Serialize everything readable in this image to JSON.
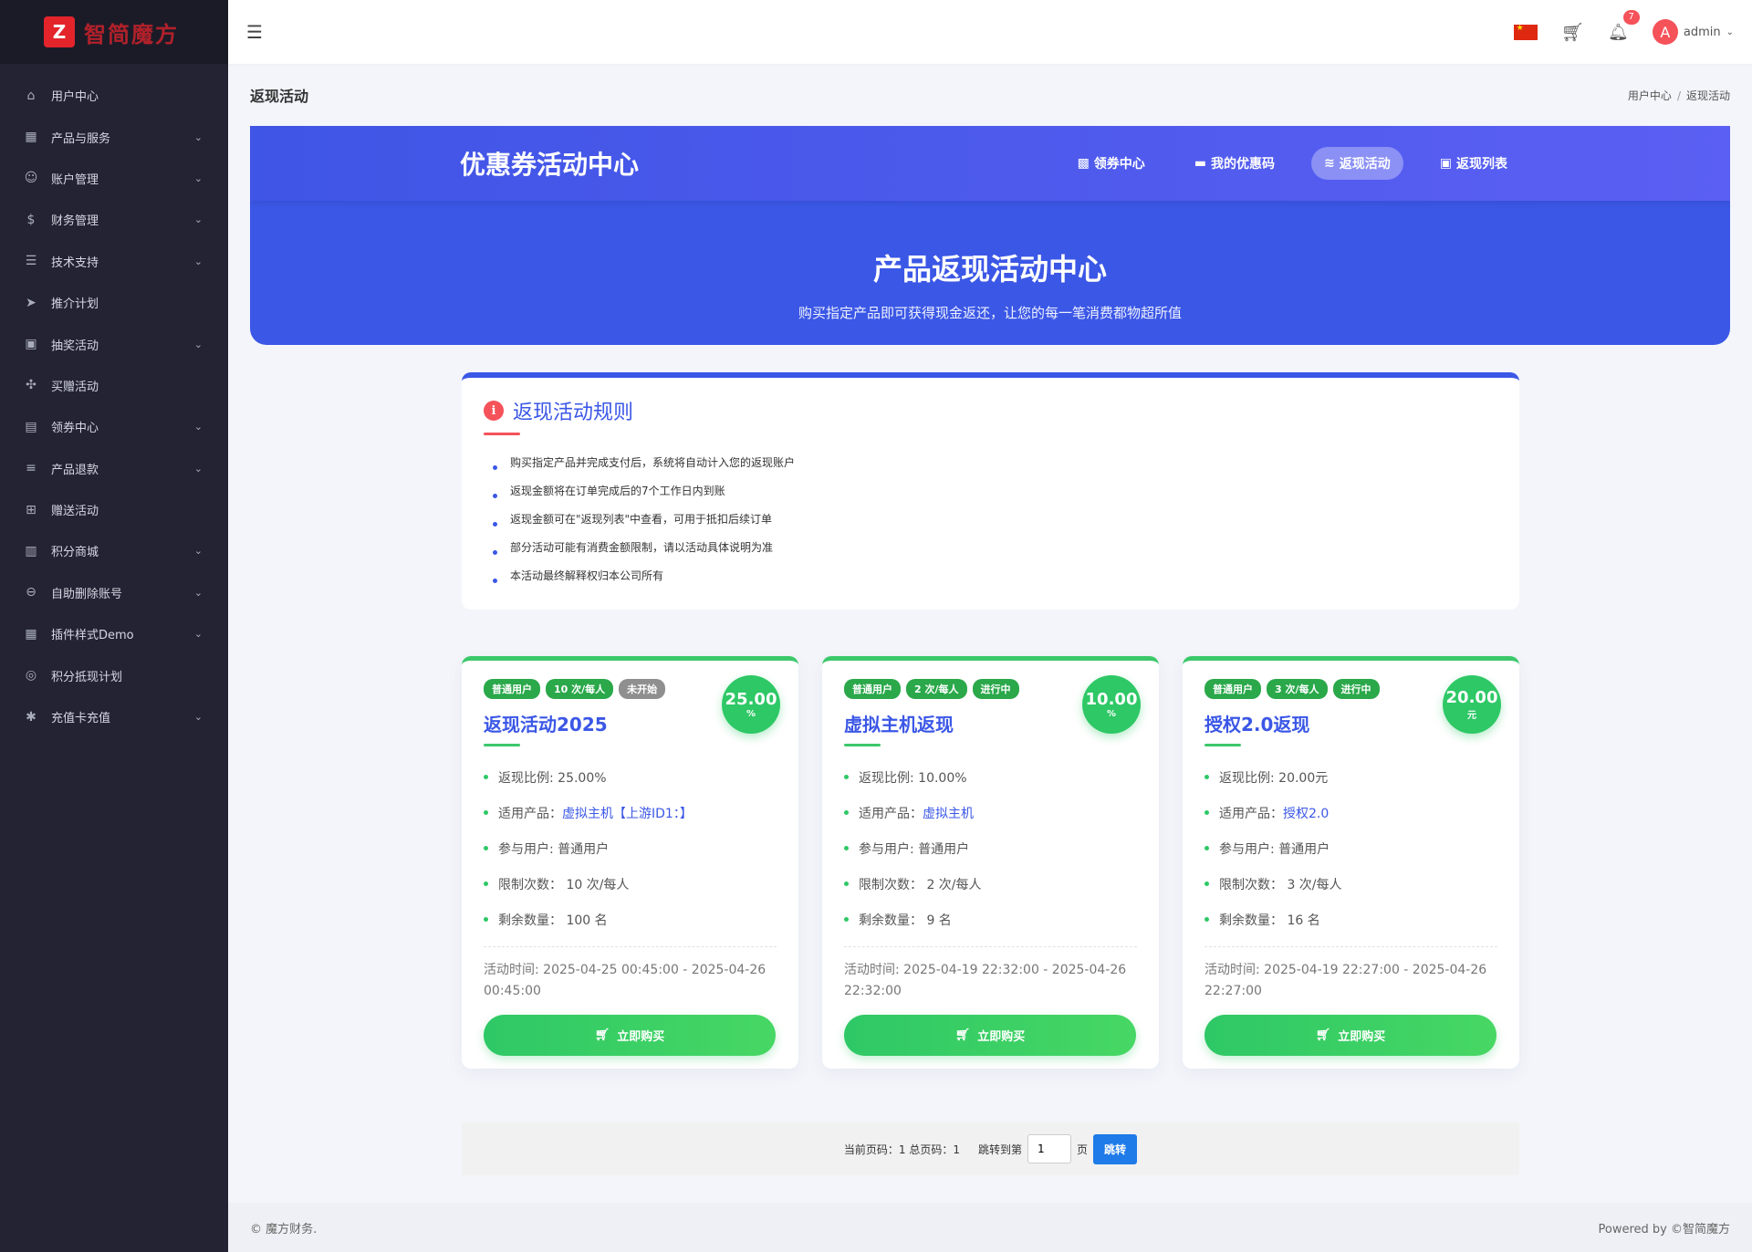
{
  "brand": {
    "logo_text": "智简魔方"
  },
  "sidebar": {
    "items": [
      {
        "label": "用户中心",
        "icon": "⌂",
        "has_children": false
      },
      {
        "label": "产品与服务",
        "icon": "▦",
        "has_children": true
      },
      {
        "label": "账户管理",
        "icon": "☺",
        "has_children": true
      },
      {
        "label": "财务管理",
        "icon": "$",
        "has_children": true
      },
      {
        "label": "技术支持",
        "icon": "☰",
        "has_children": true
      },
      {
        "label": "推介计划",
        "icon": "➤",
        "has_children": false
      },
      {
        "label": "抽奖活动",
        "icon": "▣",
        "has_children": true
      },
      {
        "label": "买赠活动",
        "icon": "✣",
        "has_children": false
      },
      {
        "label": "领券中心",
        "icon": "▤",
        "has_children": true
      },
      {
        "label": "产品退款",
        "icon": "≡",
        "has_children": true
      },
      {
        "label": "赠送活动",
        "icon": "⊞",
        "has_children": false
      },
      {
        "label": "积分商城",
        "icon": "▥",
        "has_children": true
      },
      {
        "label": "自助删除账号",
        "icon": "⊖",
        "has_children": true
      },
      {
        "label": "插件样式Demo",
        "icon": "▦",
        "has_children": true
      },
      {
        "label": "积分抵现计划",
        "icon": "◎",
        "has_children": false
      },
      {
        "label": "充值卡充值",
        "icon": "✱",
        "has_children": true
      }
    ]
  },
  "topbar": {
    "notification_count": "7",
    "username": "admin",
    "avatar_letter": "A"
  },
  "page": {
    "title": "返现活动",
    "breadcrumb": [
      "用户中心",
      "返现活动"
    ]
  },
  "hero": {
    "brand": "优惠券活动中心",
    "tabs": [
      {
        "label": "领券中心",
        "icon": "🎁",
        "active": false
      },
      {
        "label": "我的优惠码",
        "icon": "▬",
        "active": false
      },
      {
        "label": "返现活动",
        "icon": "≋",
        "active": true
      },
      {
        "label": "返现列表",
        "icon": "▣",
        "active": false
      }
    ],
    "heading": "产品返现活动中心",
    "subheading": "购买指定产品即可获得现金返还，让您的每一笔消费都物超所值"
  },
  "rules": {
    "title": "返现活动规则",
    "items": [
      "购买指定产品并完成支付后，系统将自动计入您的返现账户",
      "返现金额将在订单完成后的7个工作日内到账",
      "返现金额可在\"返现列表\"中查看，可用于抵扣后续订单",
      "部分活动可能有消费金额限制，请以活动具体说明为准",
      "本活动最终解释权归本公司所有"
    ]
  },
  "activities": [
    {
      "tags": [
        {
          "text": "普通用户",
          "grey": false
        },
        {
          "text": "10 次/每人",
          "grey": false
        },
        {
          "text": "未开始",
          "grey": true
        }
      ],
      "title": "返现活动2025",
      "value": "25.00",
      "unit": "%",
      "ratio": "返现比例: 25.00%",
      "product_label": "适用产品：",
      "product": "虚拟主机【上游ID1：】",
      "users": "参与用户: 普通用户",
      "limit": "限制次数： 10 次/每人",
      "remaining": "剩余数量： 100 名",
      "time": "活动时间: 2025-04-25 00:45:00 - 2025-04-26 00:45:00",
      "button": "立即购买"
    },
    {
      "tags": [
        {
          "text": "普通用户",
          "grey": false
        },
        {
          "text": "2 次/每人",
          "grey": false
        },
        {
          "text": "进行中",
          "grey": false
        }
      ],
      "title": "虚拟主机返现",
      "value": "10.00",
      "unit": "%",
      "ratio": "返现比例: 10.00%",
      "product_label": "适用产品：",
      "product": "虚拟主机",
      "users": "参与用户: 普通用户",
      "limit": "限制次数： 2 次/每人",
      "remaining": "剩余数量： 9 名",
      "time": "活动时间: 2025-04-19 22:32:00 - 2025-04-26 22:32:00",
      "button": "立即购买"
    },
    {
      "tags": [
        {
          "text": "普通用户",
          "grey": false
        },
        {
          "text": "3 次/每人",
          "grey": false
        },
        {
          "text": "进行中",
          "grey": false
        }
      ],
      "title": "授权2.0返现",
      "value": "20.00",
      "unit": "元",
      "ratio": "返现比例: 20.00元",
      "product_label": "适用产品：",
      "product": "授权2.0",
      "users": "参与用户: 普通用户",
      "limit": "限制次数： 3 次/每人",
      "remaining": "剩余数量： 16 名",
      "time": "活动时间: 2025-04-19 22:27:00 - 2025-04-26 22:27:00",
      "button": "立即购买"
    }
  ],
  "pager": {
    "status": "当前页码：1 总页码：1",
    "jump_prefix": "跳转到第",
    "page_value": "1",
    "page_suffix": "页",
    "jump_button": "跳转"
  },
  "footer": {
    "left": "© 魔方财务.",
    "right": "Powered by ©智简魔方"
  },
  "colors": {
    "primary": "#3b57e6",
    "green": "#2ec866",
    "sidebar": "#232334",
    "red": "#f5525a"
  }
}
